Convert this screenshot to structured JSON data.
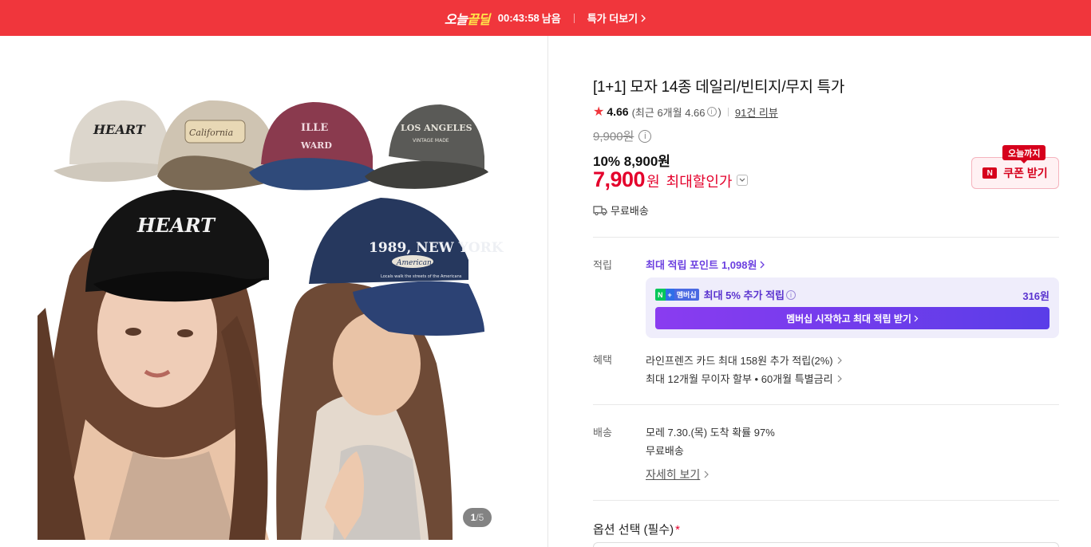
{
  "banner": {
    "brand_a": "오늘",
    "brand_b": "끝딜",
    "timer": "00:43:58",
    "remain": "남음",
    "more": "특가 더보기"
  },
  "gallery": {
    "current": "1",
    "total": "/5",
    "image_text": {
      "cap_beige": "HEART",
      "cap_patch": "California",
      "cap_burgundy_a": "ILLE",
      "cap_burgundy_b": "WARD",
      "cap_grey_a": "LOS ANGELES",
      "cap_grey_b": "VINTAGE MADE",
      "cap_black": "HEART",
      "cap_navy_a": "1989, NEW YORK",
      "cap_navy_b": "American",
      "cap_navy_c": "Locals walk the streets of the Americans"
    }
  },
  "product": {
    "title": "[1+1] 모자 14종 데일리/빈티지/무지 특가",
    "rating": "4.66",
    "recent_rating": "(최근 6개월 4.66",
    "recent_close": ")",
    "review_link": "91건 리뷰",
    "original_price": "9,900원",
    "discount_line": "10% 8,900원",
    "final_price": "7,900",
    "final_unit": "원",
    "max_discount": "최대할인가",
    "free_shipping": "무료배송",
    "coupon_tag": "오늘까지",
    "coupon_button": "쿠폰 받기"
  },
  "points": {
    "label": "적립",
    "link": "최대 적립 포인트",
    "link_value": "1,098원",
    "member_badge_a": "N",
    "member_badge_b": "+",
    "member_badge_c": "멤버십",
    "member_text": "최대 5% 추가 적립",
    "member_amount": "316원",
    "member_button": "멤버십 시작하고 최대 적립 받기"
  },
  "benefits": {
    "label": "혜택",
    "line1": "라인프렌즈 카드 최대 158원 추가 적립(2%)",
    "line2": "최대 12개월 무이자 할부 • 60개월 특별금리"
  },
  "delivery": {
    "label": "배송",
    "eta": "모레 7.30.(목) 도착 확률 97%",
    "fee": "무료배송",
    "detail": "자세히 보기"
  },
  "options": {
    "title": "옵션 선택 (필수)",
    "required_mark": "*"
  },
  "colors": {
    "banner": "#f0363c",
    "price_red": "#e4002b",
    "point_purple": "#6b3fe0",
    "member_bg": "#efedfb"
  }
}
